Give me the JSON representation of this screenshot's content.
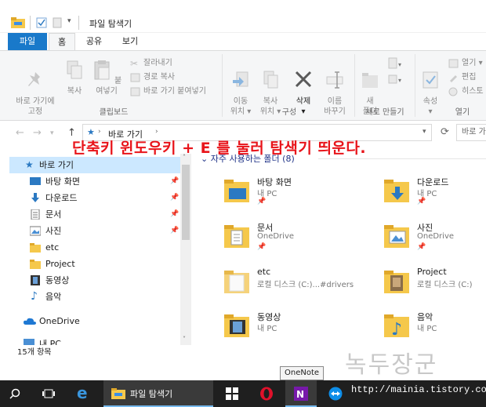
{
  "window": {
    "title": "파일 탐색기"
  },
  "tabs": [
    {
      "label": "파일"
    },
    {
      "label": "홈"
    },
    {
      "label": "공유"
    },
    {
      "label": "보기"
    }
  ],
  "ribbon": {
    "pin_label": "바로 가기에\n고정",
    "copy_label": "복사",
    "paste_label": "붙여넣기",
    "cut_label": "잘라내기",
    "copy_path_label": "경로 복사",
    "paste_shortcut_label": "바로 가기 붙여넣기",
    "clipboard_group": "클립보드",
    "move_to_label": "이동\n위치 ▾",
    "copy_to_label": "복사\n위치 ▾",
    "delete_label": "삭제\n▾",
    "rename_label": "이름\n바꾸기",
    "organize_group": "구성",
    "new_folder_label": "새\n폴더",
    "new_group": "새로 만들기",
    "properties_label": "속성\n▾",
    "open_label": "열기 ▾",
    "edit_label": "편집",
    "history_label": "히스토",
    "open_group": "열기"
  },
  "address": {
    "path": "바로 가기",
    "search_placeholder": "바로 가"
  },
  "overlay_text": "단축키 윈도우키 + E  를 눌러 탐색기 띄운다.",
  "sidebar": {
    "items": [
      {
        "label": "바로 가기"
      },
      {
        "label": "바탕 화면",
        "pin": "📌"
      },
      {
        "label": "다운로드",
        "pin": "📌"
      },
      {
        "label": "문서",
        "pin": "📌"
      },
      {
        "label": "사진",
        "pin": "📌"
      },
      {
        "label": "etc"
      },
      {
        "label": "Project"
      },
      {
        "label": "동영상"
      },
      {
        "label": "음악"
      },
      {
        "label": "OneDrive"
      },
      {
        "label": "내 PC"
      }
    ]
  },
  "content": {
    "section_header": "자주 사용하는 폴더 (8)",
    "folders": [
      {
        "name": "바탕 화면",
        "sub": "내 PC"
      },
      {
        "name": "다운로드",
        "sub": "내 PC"
      },
      {
        "name": "문서",
        "sub": "OneDrive"
      },
      {
        "name": "사진",
        "sub": "OneDrive"
      },
      {
        "name": "etc",
        "sub": "로컬 디스크 (C:)...#drivers"
      },
      {
        "name": "Project",
        "sub": "로컬 디스크 (C:)"
      },
      {
        "name": "동영상",
        "sub": "내 PC"
      },
      {
        "name": "음악",
        "sub": "내 PC"
      }
    ]
  },
  "status": {
    "count": "15개 항목"
  },
  "taskbar": {
    "explorer_label": "파일 탐색기",
    "tooltip": "OneNote"
  },
  "watermark": {
    "text": "녹두장군",
    "url": "http://mainia.tistory.com"
  },
  "colors": {
    "accent": "#1979ca",
    "overlay": "#e8141a",
    "taskbar": "#1f1f1f",
    "folder": "#f5c84b"
  }
}
